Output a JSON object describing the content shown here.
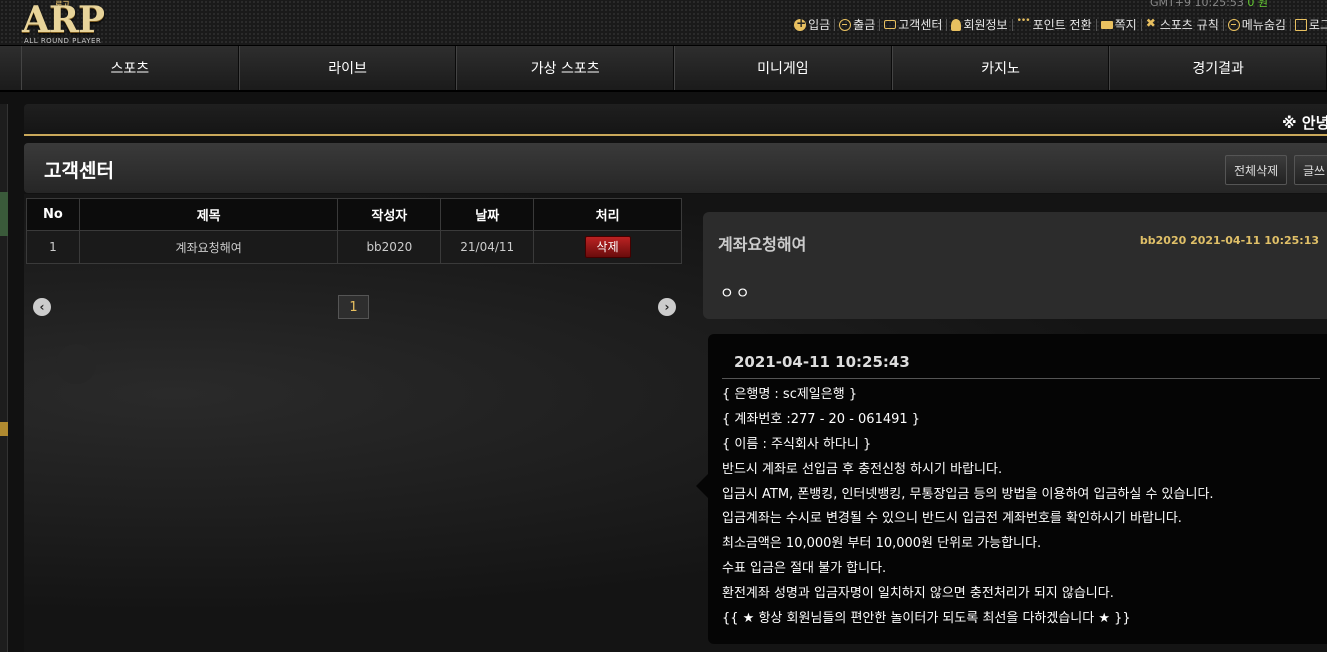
{
  "header": {
    "logo_small": "로고",
    "logo_main": "ARP",
    "logo_sub": "ALL ROUND PLAYER",
    "top_clip_left": "GMT+9 10:25:53",
    "top_clip_right": "0 원",
    "links": [
      {
        "label": "입금",
        "icon": "plus-circle-icon"
      },
      {
        "label": "출금",
        "icon": "minus-circle-icon"
      },
      {
        "label": "고객센터",
        "icon": "chat-icon"
      },
      {
        "label": "회원정보",
        "icon": "user-icon"
      },
      {
        "label": "포인트 전환",
        "icon": "dots-icon"
      },
      {
        "label": "쪽지",
        "icon": "mail-icon"
      },
      {
        "label": "스포츠 규칙",
        "icon": "cross-tools-icon"
      },
      {
        "label": "메뉴숨김",
        "icon": "minus-circle-icon"
      },
      {
        "label": "로그",
        "icon": "logout-icon"
      }
    ]
  },
  "nav": [
    "스포츠",
    "라이브",
    "가상 스포츠",
    "미니게임",
    "카지노",
    "경기결과"
  ],
  "notice": {
    "text": "※ 안녕"
  },
  "page": {
    "title": "고객센터",
    "delete_all_label": "전체삭제",
    "write_label": "글쓰"
  },
  "table": {
    "headers": [
      "No",
      "제목",
      "작성자",
      "날짜",
      "처리"
    ],
    "rows": [
      {
        "no": "1",
        "title": "계좌요청해여",
        "author": "bb2020",
        "date": "21/04/11",
        "action": "삭제"
      }
    ]
  },
  "pager": {
    "prev": "‹",
    "next": "›",
    "current": "1"
  },
  "post": {
    "title": "계좌요청해여",
    "meta": "bb2020 2021-04-11 10:25:13",
    "body": "ㅇㅇ"
  },
  "reply": {
    "timestamp": "2021-04-11 10:25:43",
    "lines": [
      "{ 은행명 : sc제일은행 }",
      "{ 계좌번호 :277 - 20 - 061491   }",
      "{ 이름 : 주식회사 하다니 }",
      "반드시 계좌로 선입금 후 충전신청 하시기 바랍니다.",
      "입금시 ATM, 폰뱅킹, 인터넷뱅킹, 무통장입금 등의 방법을 이용하여 입금하실 수 있습니다.",
      "입금계좌는 수시로 변경될 수 있으니 반드시 입금전 계좌번호를 확인하시기 바랍니다.",
      "최소금액은 10,000원 부터 10,000원 단위로 가능합니다.",
      "수표 입금은 절대 불가 합니다.",
      "환전계좌 성명과 입금자명이 일치하지 않으면 충전처리가 되지 않습니다.",
      "{{ ★ 항상 회원님들의 편안한 놀이터가 되도록 최선을 다하겠습니다 ★ }}"
    ]
  },
  "colors": {
    "accent_gold": "#c9a85a",
    "delete_red": "#b22222"
  }
}
